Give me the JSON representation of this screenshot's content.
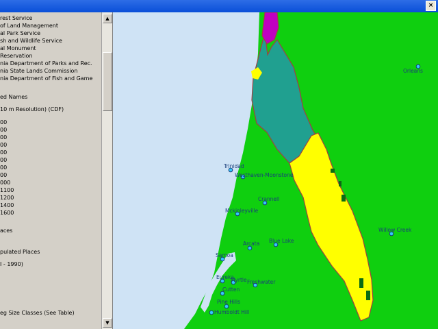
{
  "window": {
    "close_label": "×"
  },
  "legend": {
    "items": [
      "rest Service",
      "of Land Management",
      "al Park Service",
      "sh and Wildlife Service",
      "al Monument",
      "Reservation",
      "nia Department of Parks and Rec.",
      "nia State Lands Commission",
      "nia Department of Fish and Game",
      "ed Names",
      "10 m Resolution) (CDF)",
      "00",
      "00",
      "00",
      "00",
      "00",
      "00",
      "00",
      "00",
      "000",
      "1100",
      "1200",
      "1400",
      "1600",
      "aces",
      "pulated Places",
      "I - 1990)",
      "eg Size Classes (See Table)"
    ]
  },
  "scrollbar": {
    "up_arrow": "▲",
    "down_arrow": "▼"
  },
  "map": {
    "colors": {
      "ocean": "#cfe3f5",
      "land": "#0fcf0f",
      "usfs": "#20a090",
      "blm": "#ffff00",
      "parks": "#c000c0",
      "dark_patch": "#0b6b14",
      "boundary": "#a04040",
      "place_dot": "#1a3d7a"
    },
    "places": [
      {
        "name": "Orleans"
      },
      {
        "name": "Trinidad"
      },
      {
        "name": "Westhaven-Moonstone"
      },
      {
        "name": "Crannell"
      },
      {
        "name": "Mckinleyville"
      },
      {
        "name": "Willow Creek"
      },
      {
        "name": "Arcata"
      },
      {
        "name": "Blue Lake"
      },
      {
        "name": "Samoa"
      },
      {
        "name": "Eureka"
      },
      {
        "name": "Myrtle"
      },
      {
        "name": "Freshwater"
      },
      {
        "name": "Cutten"
      },
      {
        "name": "Pine Hills"
      },
      {
        "name": "Humboldt Hill"
      }
    ]
  }
}
